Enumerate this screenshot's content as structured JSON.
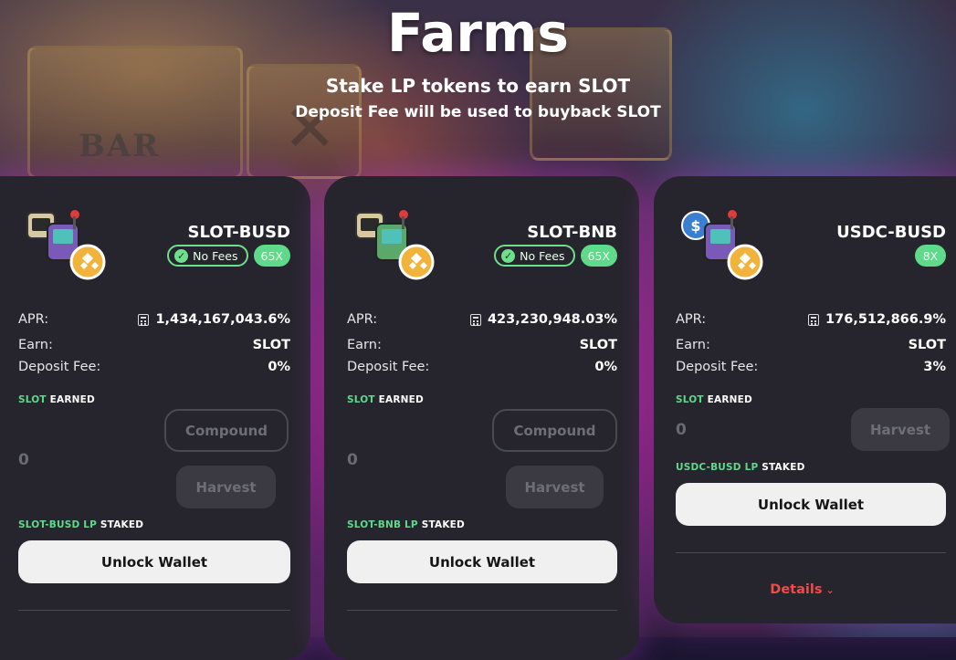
{
  "header": {
    "title": "Farms",
    "subtitle": "Stake LP tokens to earn SLOT",
    "note": "Deposit Fee will be used to buyback SLOT"
  },
  "background": {
    "reel_text": "BAR"
  },
  "labels": {
    "apr": "APR:",
    "earn": "Earn:",
    "deposit_fee": "Deposit Fee:",
    "earned_token": "SLOT",
    "earned_suffix": "EARNED",
    "staked_suffix": "STAKED",
    "compound": "Compound",
    "harvest": "Harvest",
    "unlock": "Unlock Wallet",
    "details": "Details"
  },
  "farms": [
    {
      "name": "SLOT-BUSD",
      "fee_badge": "No Fees",
      "multiplier": "65X",
      "apr": "1,434,167,043.6%",
      "earn": "SLOT",
      "deposit_fee": "0%",
      "earned_value": "0",
      "lp_name": "SLOT-BUSD LP"
    },
    {
      "name": "SLOT-BNB",
      "fee_badge": "No Fees",
      "multiplier": "65X",
      "apr": "423,230,948.03%",
      "earn": "SLOT",
      "deposit_fee": "0%",
      "earned_value": "0",
      "lp_name": "SLOT-BNB LP"
    },
    {
      "name": "USDC-BUSD",
      "multiplier": "8X",
      "apr": "176,512,866.9%",
      "earn": "SLOT",
      "deposit_fee": "3%",
      "earned_value": "0",
      "lp_name": "USDC-BUSD LP"
    }
  ],
  "icons": {
    "check": "check-circle-icon",
    "calculator": "calculator-icon",
    "chevron": "chevron-down-icon",
    "token_logo": "slot-machine-token-logo"
  },
  "colors": {
    "accent_green": "#5fd98a",
    "card_bg": "#26252d",
    "details_red": "#f04a4a",
    "glow": "#c83cdc"
  }
}
